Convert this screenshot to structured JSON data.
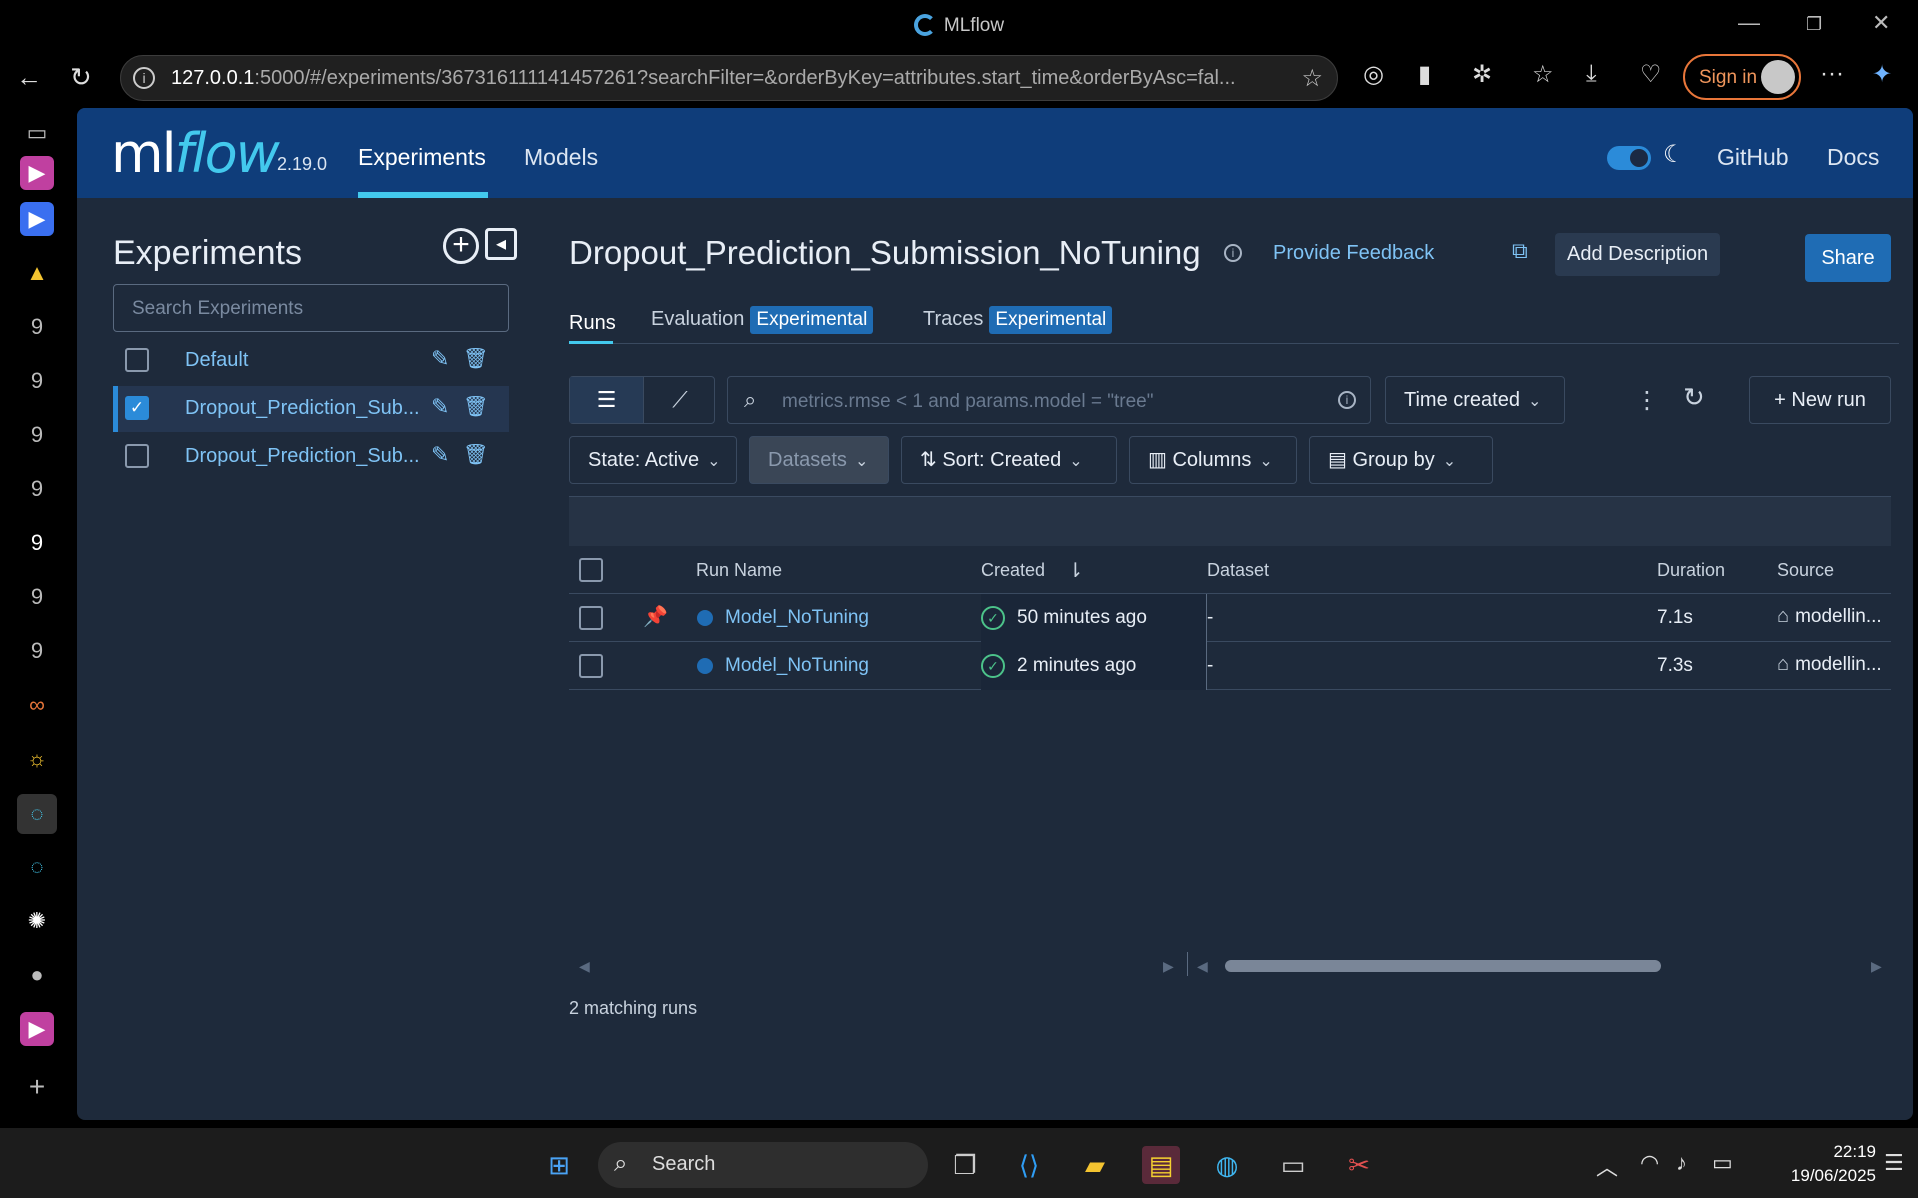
{
  "window": {
    "title": "MLflow"
  },
  "browser": {
    "url_host": "127.0.0.1",
    "url_rest": ":5000/#/experiments/367316111141457261?searchFilter=&orderByKey=attributes.start_time&orderByAsc=fal...",
    "signin_label": "Sign in"
  },
  "header": {
    "brand_ml": "ml",
    "brand_flow": "flow",
    "version": "2.19.0",
    "nav": [
      "Experiments",
      "Models"
    ],
    "links": [
      "GitHub",
      "Docs"
    ]
  },
  "sidebar": {
    "title": "Experiments",
    "search_placeholder": "Search Experiments",
    "experiments": [
      {
        "name": "Default",
        "checked": false
      },
      {
        "name": "Dropout_Prediction_Sub...",
        "checked": true
      },
      {
        "name": "Dropout_Prediction_Sub...",
        "checked": false
      }
    ]
  },
  "main": {
    "title": "Dropout_Prediction_Submission_NoTuning",
    "feedback_label": "Provide Feedback",
    "add_description_label": "Add Description",
    "share_label": "Share",
    "tabs": [
      {
        "label": "Runs",
        "badge": ""
      },
      {
        "label": "Evaluation",
        "badge": "Experimental"
      },
      {
        "label": "Traces",
        "badge": "Experimental"
      }
    ],
    "search_placeholder": "metrics.rmse < 1 and params.model = \"tree\"",
    "time_created_label": "Time created",
    "new_run_label": "New run",
    "filters": {
      "state": "State: Active",
      "datasets": "Datasets",
      "sort": "Sort: Created",
      "columns": "Columns",
      "group_by": "Group by"
    },
    "table": {
      "headers": [
        "Run Name",
        "Created",
        "Dataset",
        "Duration",
        "Source"
      ],
      "rows": [
        {
          "name": "Model_NoTuning",
          "created": "50 minutes ago",
          "dataset": "-",
          "duration": "7.1s",
          "source": "modellin...",
          "pinned": true
        },
        {
          "name": "Model_NoTuning",
          "created": "2 minutes ago",
          "dataset": "-",
          "duration": "7.3s",
          "source": "modellin...",
          "pinned": false
        }
      ]
    },
    "matching_runs": "2 matching runs"
  },
  "taskbar": {
    "search_label": "Search",
    "time": "22:19",
    "date": "19/06/2025"
  },
  "colors": {
    "header_bg": "#0f3d7a",
    "app_bg": "#1e2a3b",
    "accent": "#43c9ed",
    "link": "#7fc3f5",
    "primary_button": "#1f6cb4"
  }
}
